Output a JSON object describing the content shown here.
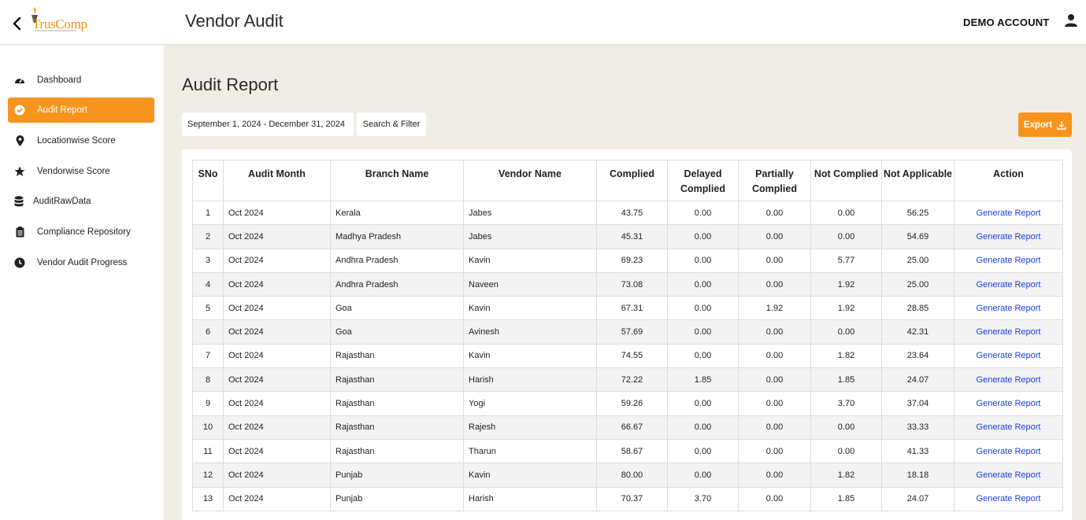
{
  "header": {
    "logo_text": "TrusComp",
    "title": "Vendor Audit",
    "account": "DEMO ACCOUNT",
    "icons": [
      "chevron-left-icon",
      "user-icon"
    ]
  },
  "sidebar": {
    "items": [
      {
        "label": "Dashboard",
        "icon": "dashboard-icon",
        "active": false
      },
      {
        "label": "Audit Report",
        "icon": "check-circle-icon",
        "active": true
      },
      {
        "label": "Locationwise Score",
        "icon": "map-pin-icon",
        "active": false
      },
      {
        "label": "Vendorwise Score",
        "icon": "star-icon",
        "active": false
      },
      {
        "label": "AuditRawData",
        "icon": "database-icon",
        "active": false
      },
      {
        "label": "Compliance Repository",
        "icon": "clipboard-icon",
        "active": false
      },
      {
        "label": "Vendor Audit Progress",
        "icon": "clock-icon",
        "active": false
      }
    ]
  },
  "main": {
    "title": "Audit Report",
    "date_range": "September 1, 2024 - December 31, 2024",
    "search_label": "Search & Filter",
    "export_label": "Export"
  },
  "table": {
    "headers": [
      "SNo",
      "Audit Month",
      "Branch Name",
      "Vendor Name",
      "Complied",
      "Delayed Complied",
      "Partially Complied",
      "Not Complied",
      "Not Applicable",
      "Action"
    ],
    "rows": [
      [
        "1",
        "Oct 2024",
        "Kerala",
        "Jabes",
        "43.75",
        "0.00",
        "0.00",
        "0.00",
        "56.25",
        "Generate Report"
      ],
      [
        "2",
        "Oct 2024",
        "Madhya Pradesh",
        "Jabes",
        "45.31",
        "0.00",
        "0.00",
        "0.00",
        "54.69",
        "Generate Report"
      ],
      [
        "3",
        "Oct 2024",
        "Andhra Pradesh",
        "Kavin",
        "69.23",
        "0.00",
        "0.00",
        "5.77",
        "25.00",
        "Generate Report"
      ],
      [
        "4",
        "Oct 2024",
        "Andhra Pradesh",
        "Naveen",
        "73.08",
        "0.00",
        "0.00",
        "1.92",
        "25.00",
        "Generate Report"
      ],
      [
        "5",
        "Oct 2024",
        "Goa",
        "Kavin",
        "67.31",
        "0.00",
        "1.92",
        "1.92",
        "28.85",
        "Generate Report"
      ],
      [
        "6",
        "Oct 2024",
        "Goa",
        "Avinesh",
        "57.69",
        "0.00",
        "0.00",
        "0.00",
        "42.31",
        "Generate Report"
      ],
      [
        "7",
        "Oct 2024",
        "Rajasthan",
        "Kavin",
        "74.55",
        "0.00",
        "0.00",
        "1.82",
        "23.64",
        "Generate Report"
      ],
      [
        "8",
        "Oct 2024",
        "Rajasthan",
        "Harish",
        "72.22",
        "1.85",
        "0.00",
        "1.85",
        "24.07",
        "Generate Report"
      ],
      [
        "9",
        "Oct 2024",
        "Rajasthan",
        "Yogi",
        "59.26",
        "0.00",
        "0.00",
        "3.70",
        "37.04",
        "Generate Report"
      ],
      [
        "10",
        "Oct 2024",
        "Rajasthan",
        "Rajesh",
        "66.67",
        "0.00",
        "0.00",
        "0.00",
        "33.33",
        "Generate Report"
      ],
      [
        "11",
        "Oct 2024",
        "Rajasthan",
        "Tharun",
        "58.67",
        "0.00",
        "0.00",
        "0.00",
        "41.33",
        "Generate Report"
      ],
      [
        "12",
        "Oct 2024",
        "Punjab",
        "Kavin",
        "80.00",
        "0.00",
        "0.00",
        "1.82",
        "18.18",
        "Generate Report"
      ],
      [
        "13",
        "Oct 2024",
        "Punjab",
        "Harish",
        "70.37",
        "3.70",
        "0.00",
        "1.85",
        "24.07",
        "Generate Report"
      ]
    ]
  },
  "colors": {
    "accent": "#f7941d",
    "link": "#1a3ee8",
    "page_bg": "#f0ede7"
  }
}
